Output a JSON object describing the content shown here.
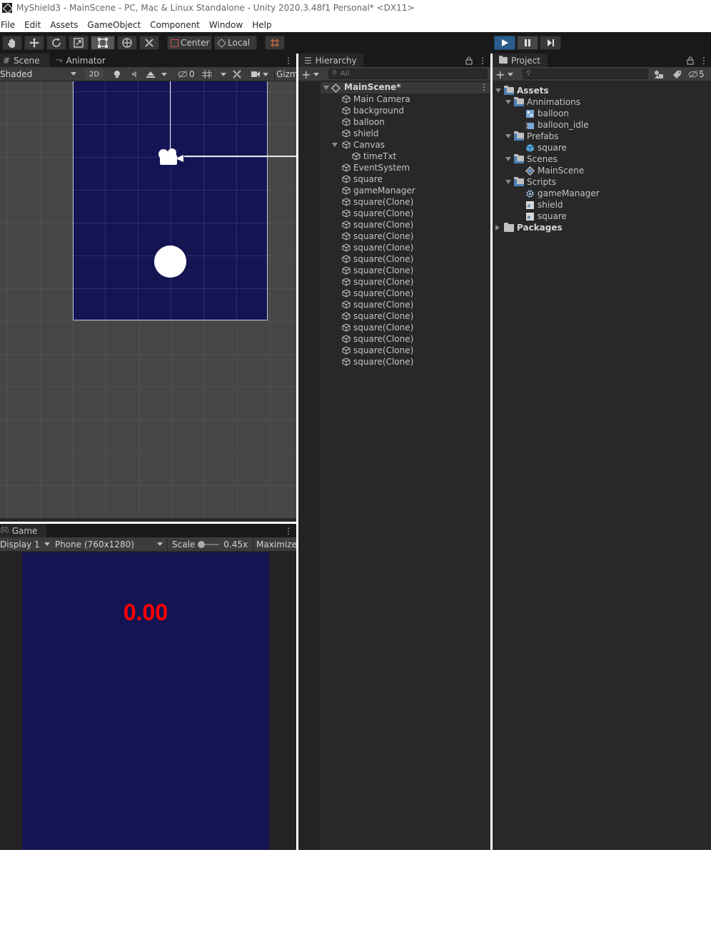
{
  "title": "MyShield3 - MainScene - PC, Mac & Linux Standalone - Unity 2020.3.48f1 Personal* <DX11>",
  "menu": [
    "File",
    "Edit",
    "Assets",
    "GameObject",
    "Component",
    "Window",
    "Help"
  ],
  "toolbar": {
    "pivot_label": "Center",
    "space_label": "Local"
  },
  "scene": {
    "tab_scene": "Scene",
    "tab_animator": "Animator",
    "shading": "Shaded",
    "mode_2d": "2D",
    "hidden_count": "0",
    "gizmos": "Gizm"
  },
  "game": {
    "tab": "Game",
    "display": "Display 1",
    "resolution": "Phone (760x1280)",
    "scale_label": "Scale",
    "scale_value": "0.45x",
    "maximize": "Maximize",
    "timer": "0.00",
    "timer_color": "#ff0000",
    "bg_color": "#141452"
  },
  "hierarchy": {
    "tab": "Hierarchy",
    "search_placeholder": "All",
    "scene": "MainScene*",
    "items": [
      {
        "label": "Main Camera",
        "depth": 1
      },
      {
        "label": "background",
        "depth": 1
      },
      {
        "label": "balloon",
        "depth": 1
      },
      {
        "label": "shield",
        "depth": 1
      },
      {
        "label": "Canvas",
        "depth": 1,
        "expanded": true
      },
      {
        "label": "timeTxt",
        "depth": 2
      },
      {
        "label": "EventSystem",
        "depth": 1
      },
      {
        "label": "square",
        "depth": 1
      },
      {
        "label": "gameManager",
        "depth": 1
      },
      {
        "label": "square(Clone)",
        "depth": 1
      },
      {
        "label": "square(Clone)",
        "depth": 1
      },
      {
        "label": "square(Clone)",
        "depth": 1
      },
      {
        "label": "square(Clone)",
        "depth": 1
      },
      {
        "label": "square(Clone)",
        "depth": 1
      },
      {
        "label": "square(Clone)",
        "depth": 1
      },
      {
        "label": "square(Clone)",
        "depth": 1
      },
      {
        "label": "square(Clone)",
        "depth": 1
      },
      {
        "label": "square(Clone)",
        "depth": 1
      },
      {
        "label": "square(Clone)",
        "depth": 1
      },
      {
        "label": "square(Clone)",
        "depth": 1
      },
      {
        "label": "square(Clone)",
        "depth": 1
      },
      {
        "label": "square(Clone)",
        "depth": 1
      },
      {
        "label": "square(Clone)",
        "depth": 1
      },
      {
        "label": "square(Clone)",
        "depth": 1
      }
    ]
  },
  "project": {
    "tab": "Project",
    "hidden_count": "5",
    "items": [
      {
        "label": "Assets",
        "depth": 0,
        "kind": "folder",
        "expanded": true,
        "bold": true
      },
      {
        "label": "Annimations",
        "depth": 1,
        "kind": "folder",
        "expanded": true
      },
      {
        "label": "balloon",
        "depth": 2,
        "kind": "anim-controller"
      },
      {
        "label": "balloon_idle",
        "depth": 2,
        "kind": "anim-clip"
      },
      {
        "label": "Prefabs",
        "depth": 1,
        "kind": "folder",
        "expanded": true
      },
      {
        "label": "square",
        "depth": 2,
        "kind": "prefab"
      },
      {
        "label": "Scenes",
        "depth": 1,
        "kind": "folder",
        "expanded": true
      },
      {
        "label": "MainScene",
        "depth": 2,
        "kind": "scene"
      },
      {
        "label": "Scripts",
        "depth": 1,
        "kind": "folder",
        "expanded": true
      },
      {
        "label": "gameManager",
        "depth": 2,
        "kind": "manager-script"
      },
      {
        "label": "shield",
        "depth": 2,
        "kind": "script"
      },
      {
        "label": "square",
        "depth": 2,
        "kind": "script"
      },
      {
        "label": "Packages",
        "depth": 0,
        "kind": "folder",
        "expanded": false,
        "bold": true
      }
    ]
  }
}
